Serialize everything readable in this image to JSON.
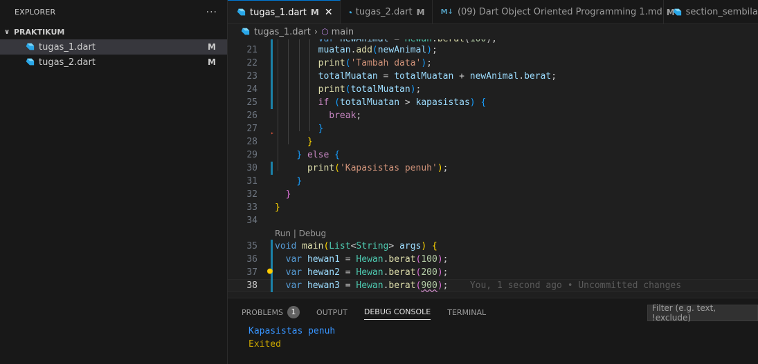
{
  "sidebar": {
    "title": "EXPLORER",
    "more": "···",
    "section": "PRAKTIKUM",
    "files": [
      {
        "name": "tugas_1.dart",
        "badge": "M"
      },
      {
        "name": "tugas_2.dart",
        "badge": "M"
      }
    ]
  },
  "tabs": [
    {
      "label": "tugas_1.dart",
      "mod": "M",
      "icon": "dart-icon"
    },
    {
      "label": "tugas_2.dart",
      "mod": "M",
      "icon": "dart-icon"
    },
    {
      "label": "(09) Dart Object Oriented Programming 1.md",
      "mod": "M",
      "icon": "markdown-icon"
    },
    {
      "label": "section_sembilan_",
      "icon": "dart-icon"
    }
  ],
  "breadcrumb": {
    "file": "tugas_1.dart",
    "symbol": "main"
  },
  "editor": {
    "lines": [
      {
        "n": "21"
      },
      {
        "n": "22"
      },
      {
        "n": "23"
      },
      {
        "n": "24"
      },
      {
        "n": "25"
      },
      {
        "n": "26"
      },
      {
        "n": "27"
      },
      {
        "n": "28"
      },
      {
        "n": "29"
      },
      {
        "n": "30"
      },
      {
        "n": "31"
      },
      {
        "n": "32"
      },
      {
        "n": "33"
      },
      {
        "n": "34"
      },
      {
        "n": "35"
      },
      {
        "n": "36"
      },
      {
        "n": "37"
      },
      {
        "n": "38"
      }
    ],
    "codelens": "Run | Debug",
    "blame": "You, 1 second ago • Uncommitted changes"
  },
  "panel": {
    "tabs": [
      "PROBLEMS",
      "OUTPUT",
      "DEBUG CONSOLE",
      "TERMINAL"
    ],
    "problem_count": "1",
    "filter_placeholder": "Filter (e.g. text, !exclude)",
    "output": [
      "Kapasistas penuh",
      "Exited"
    ]
  }
}
